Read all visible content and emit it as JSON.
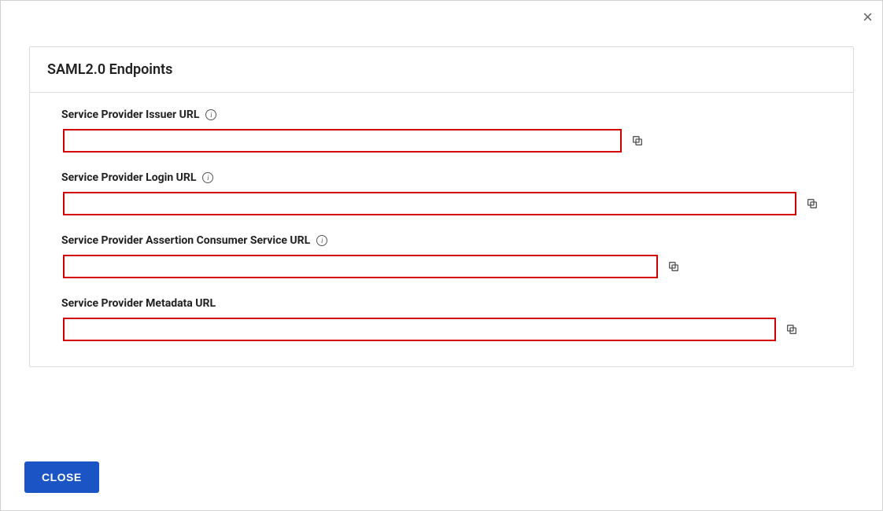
{
  "dialog": {
    "close_x": "×",
    "panel_title": "SAML2.0 Endpoints",
    "close_button_label": "CLOSE"
  },
  "fields": {
    "issuer": {
      "label": "Service Provider Issuer URL",
      "has_info": true,
      "value": ""
    },
    "login": {
      "label": "Service Provider Login URL",
      "has_info": true,
      "value": ""
    },
    "acs": {
      "label": "Service Provider Assertion Consumer Service URL",
      "has_info": true,
      "value": ""
    },
    "metadata": {
      "label": "Service Provider Metadata URL",
      "has_info": false,
      "value": ""
    }
  },
  "icons": {
    "info_glyph": "i"
  }
}
